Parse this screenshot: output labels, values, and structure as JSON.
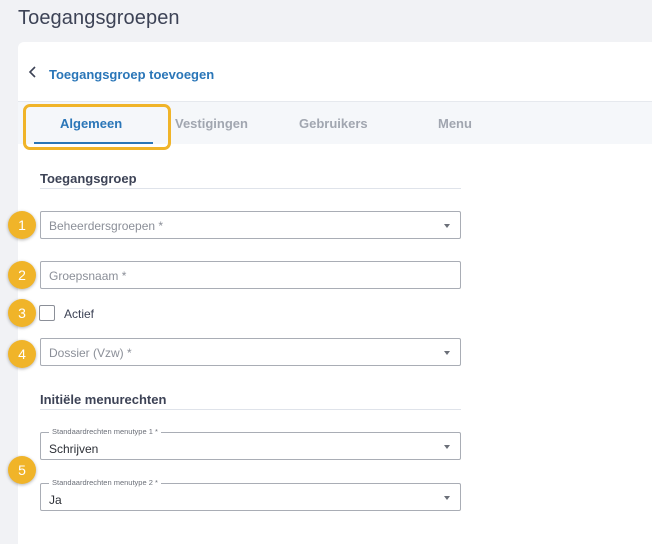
{
  "page": {
    "title": "Toegangsgroepen"
  },
  "header": {
    "title": "Toegangsgroep toevoegen",
    "back_icon": "chevron-left-icon"
  },
  "tabs": [
    {
      "label": "Algemeen",
      "active": true
    },
    {
      "label": "Vestigingen",
      "active": false
    },
    {
      "label": "Gebruikers",
      "active": false
    },
    {
      "label": "Menu",
      "active": false
    }
  ],
  "section_toegangsgroep": {
    "title": "Toegangsgroep",
    "beheerdersgroepen": {
      "placeholder": "Beheerdersgroepen *"
    },
    "groepsnaam": {
      "placeholder": "Groepsnaam *"
    },
    "actief": {
      "label": "Actief",
      "checked": false
    },
    "dossier": {
      "placeholder": "Dossier (Vzw) *"
    }
  },
  "section_menurechten": {
    "title": "Initiële menurechten",
    "menutype1": {
      "label": "Standaardrechten menutype 1 *",
      "value": "Schrijven"
    },
    "menutype2": {
      "label": "Standaardrechten menutype 2 *",
      "value": "Ja"
    }
  },
  "badges": [
    "1",
    "2",
    "3",
    "4",
    "5"
  ],
  "colors": {
    "accent": "#2a76b8",
    "highlight": "#f0b429",
    "text": "#3d4356"
  }
}
